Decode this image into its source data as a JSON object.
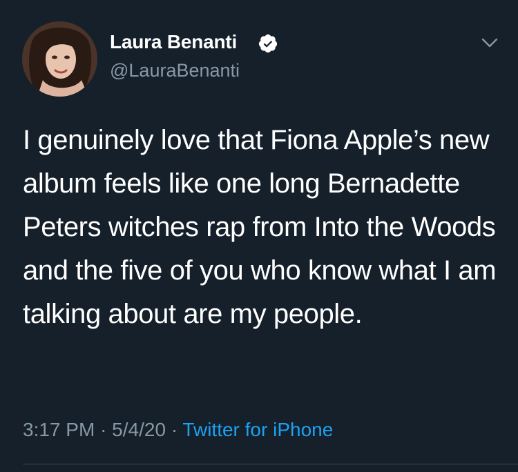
{
  "tweet": {
    "display_name": "Laura Benanti",
    "handle": "@LauraBenanti",
    "verified": true,
    "text": "I genuinely love that Fiona Apple’s new album feels like one long Bernadette Peters witches rap from Into the Woods and the five of you who know what I am talking about are my people.",
    "time": "3:17 PM",
    "date": "5/4/20",
    "separator": "·",
    "source": "Twitter for iPhone"
  },
  "icons": {
    "verified": "verified-badge-icon",
    "menu": "chevron-down-icon"
  },
  "colors": {
    "background": "#15202b",
    "primary_text": "#ffffff",
    "secondary_text": "#8899a6",
    "link": "#1da1f2",
    "divider": "#38444d"
  }
}
